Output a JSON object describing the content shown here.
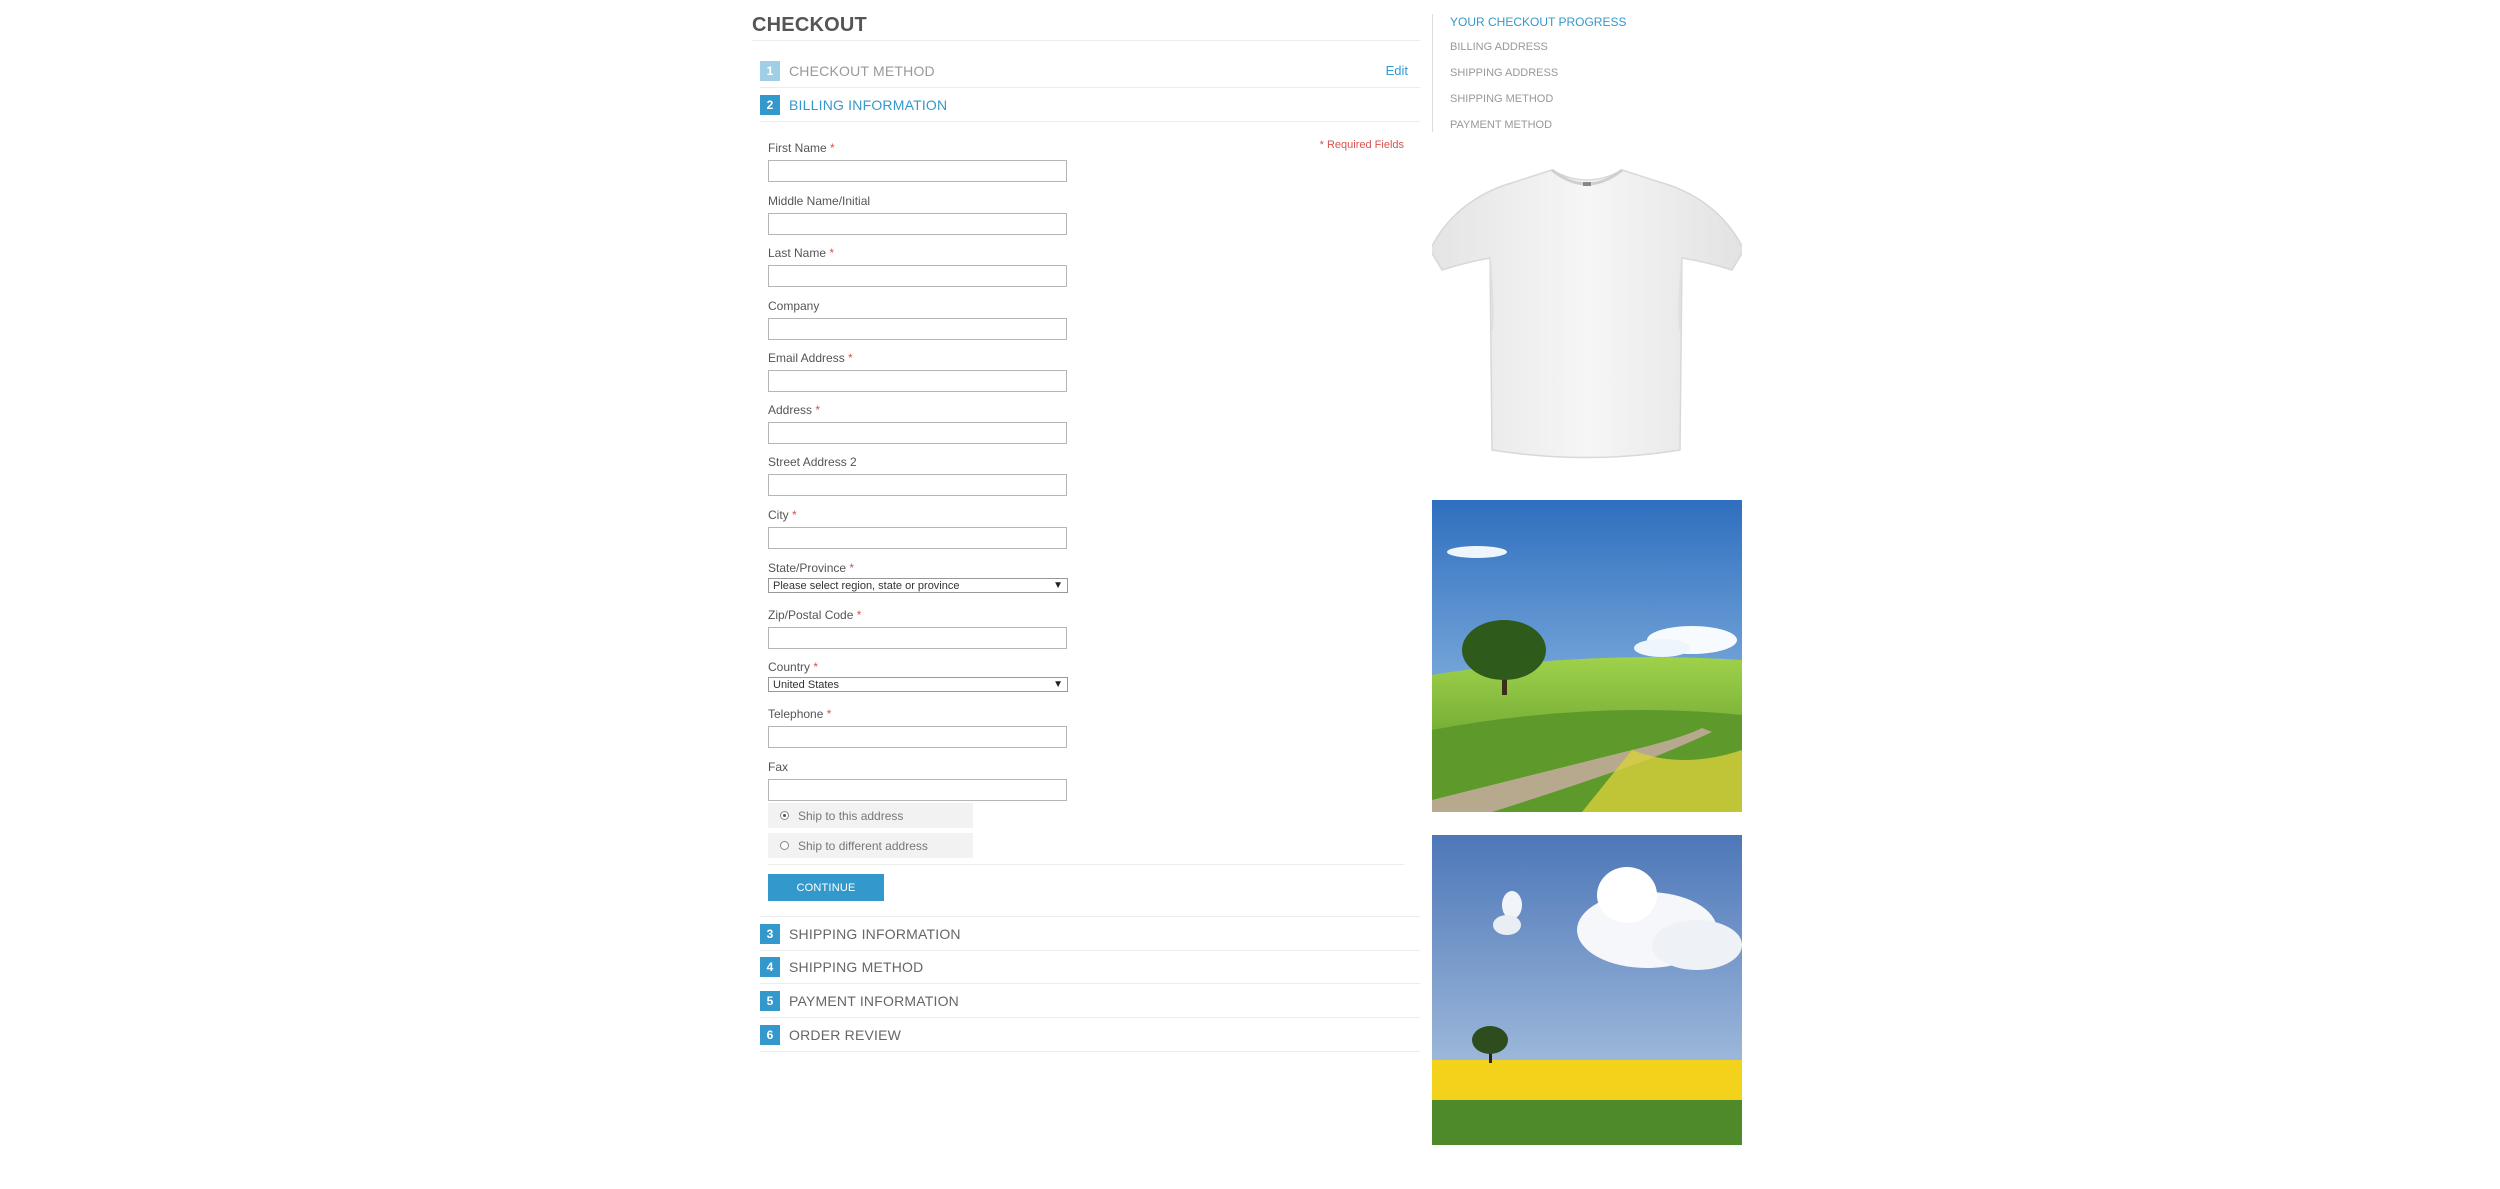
{
  "page": {
    "title": "CHECKOUT"
  },
  "steps": [
    {
      "num": "1",
      "label": "CHECKOUT METHOD",
      "edit": "Edit"
    },
    {
      "num": "2",
      "label": "BILLING INFORMATION"
    },
    {
      "num": "3",
      "label": "SHIPPING INFORMATION"
    },
    {
      "num": "4",
      "label": "SHIPPING METHOD"
    },
    {
      "num": "5",
      "label": "PAYMENT INFORMATION"
    },
    {
      "num": "6",
      "label": "ORDER REVIEW"
    }
  ],
  "billing": {
    "required_note": "* Required Fields",
    "fields": {
      "first_name": "First Name",
      "middle_name": "Middle Name/Initial",
      "last_name": "Last Name",
      "company": "Company",
      "email": "Email Address",
      "address": "Address",
      "street2": "Street Address 2",
      "city": "City",
      "state": "State/Province",
      "zip": "Zip/Postal Code",
      "country": "Country",
      "telephone": "Telephone",
      "fax": "Fax"
    },
    "required_star": "*",
    "state_value": "Please select region, state or province",
    "country_value": "United States",
    "select_caret": "▼",
    "ship_options": [
      "Ship to this address",
      "Ship to different address"
    ],
    "continue_label": "CONTINUE"
  },
  "sidebar": {
    "progress_title": "YOUR CHECKOUT PROGRESS",
    "progress_items": [
      "BILLING ADDRESS",
      "SHIPPING ADDRESS",
      "SHIPPING METHOD",
      "PAYMENT METHOD"
    ]
  },
  "colors": {
    "accent": "#3399cc",
    "required": "#d9534f",
    "muted": "#999999"
  }
}
